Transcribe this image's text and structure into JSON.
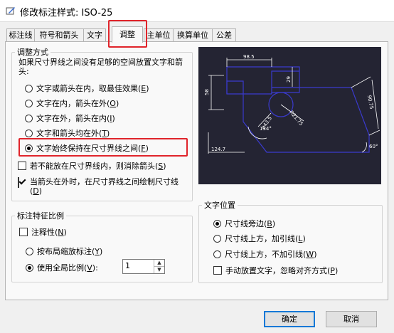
{
  "window": {
    "title": "修改标注样式: ISO-25"
  },
  "tabs": [
    {
      "label": "标注线"
    },
    {
      "label": "符号和箭头"
    },
    {
      "label": "文字"
    },
    {
      "label": "调整"
    },
    {
      "label": "主单位"
    },
    {
      "label": "换算单位"
    },
    {
      "label": "公差"
    }
  ],
  "active_tab": "调整",
  "fit_options": {
    "title": "调整方式",
    "description": "如果尺寸界线之间没有足够的空间放置文字和箭头:",
    "radios": [
      {
        "label": "文字或箭头在内，取最佳效果",
        "key": "E",
        "selected": false
      },
      {
        "label": "文字在内，箭头在外",
        "key": "O",
        "selected": false
      },
      {
        "label": "文字在外，箭头在内",
        "key": "I",
        "selected": false
      },
      {
        "label": "文字和箭头均在外",
        "key": "T",
        "selected": false
      },
      {
        "label": "文字始终保持在尺寸界线之间",
        "key": "F",
        "selected": true
      }
    ],
    "checks": [
      {
        "label": "若不能放在尺寸界线内，则消除箭头",
        "key": "S",
        "checked": false
      },
      {
        "label": "当箭头在外时，在尺寸界线之间绘制尺寸线",
        "key": "D",
        "checked": true
      }
    ]
  },
  "preview": {
    "labels": [
      "98.5",
      "58",
      "29",
      "90.75",
      "R21.75",
      "ø43.5",
      "124.7",
      "134°",
      "60°"
    ],
    "colors": {
      "background": "#242433",
      "geometry": "#3a3acd",
      "dimension": "#ffffff"
    }
  },
  "text_placement": {
    "title": "文字位置",
    "radios": [
      {
        "label": "尺寸线旁边",
        "key": "B",
        "selected": true
      },
      {
        "label": "尺寸线上方，加引线",
        "key": "L",
        "selected": false
      },
      {
        "label": "尺寸线上方，不加引线",
        "key": "W",
        "selected": false
      }
    ],
    "check": {
      "label": "手动放置文字，忽略对齐方式",
      "key": "P",
      "checked": false
    }
  },
  "scale": {
    "title": "标注特征比例",
    "annotative": {
      "label": "注释性",
      "key": "N",
      "checked": false
    },
    "radios": [
      {
        "label": "按布局缩放标注",
        "key": "Y",
        "selected": false
      },
      {
        "label": "使用全局比例",
        "key": "V",
        "suffix": ":",
        "selected": true
      }
    ],
    "value": "1"
  },
  "buttons": {
    "ok": "确定",
    "cancel": "取消"
  },
  "colors": {
    "highlight": "#e0242b",
    "focus": "#0078d7"
  }
}
